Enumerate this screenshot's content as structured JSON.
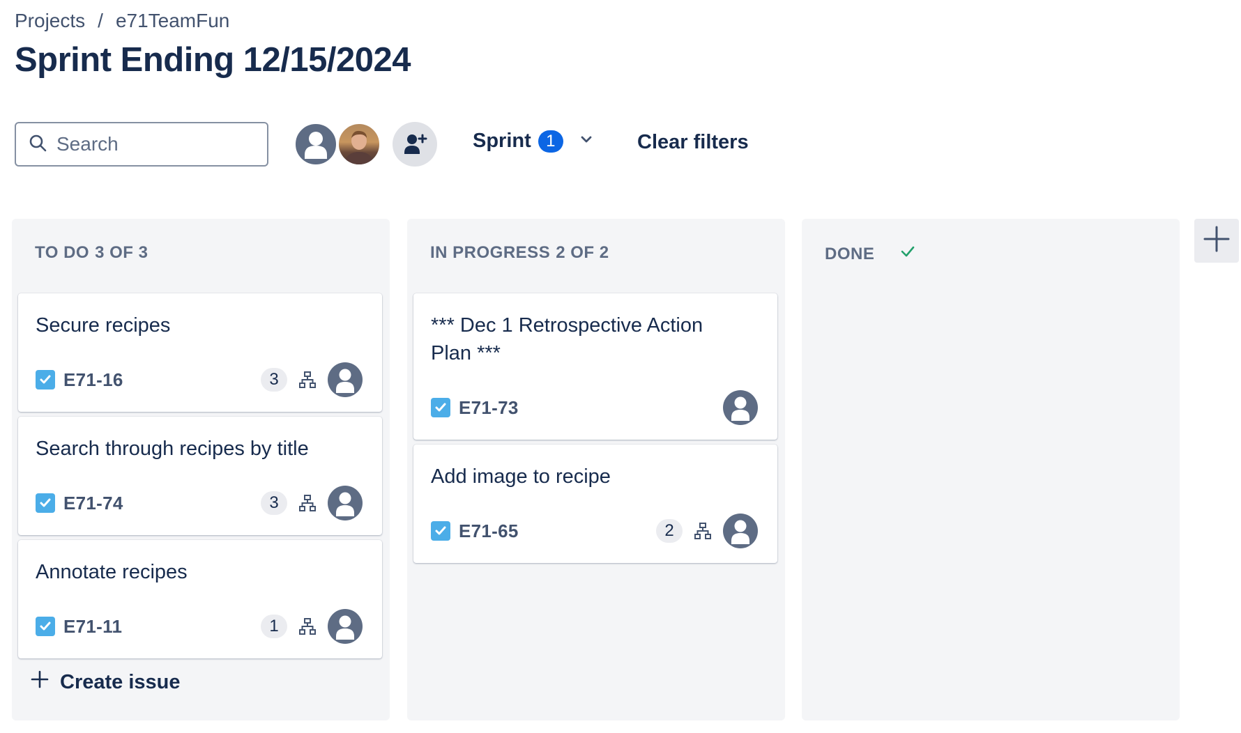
{
  "breadcrumb": {
    "projects": "Projects",
    "separator": "/",
    "project": "e71TeamFun"
  },
  "page_title": "Sprint Ending 12/15/2024",
  "toolbar": {
    "search_placeholder": "Search",
    "sprint_label": "Sprint",
    "sprint_count": "1",
    "clear_filters": "Clear filters"
  },
  "columns": [
    {
      "name": "TO DO",
      "count_text": "3 OF 3",
      "cards": [
        {
          "title": "Secure recipes",
          "key": "E71-16",
          "subtasks": "3"
        },
        {
          "title": "Search through recipes by title",
          "key": "E71-74",
          "subtasks": "3"
        },
        {
          "title": "Annotate recipes",
          "key": "E71-11",
          "subtasks": "1"
        }
      ],
      "create_issue": "Create issue"
    },
    {
      "name": "IN PROGRESS",
      "count_text": "2 OF 2",
      "cards": [
        {
          "title": "*** Dec 1 Retrospective Action Plan ***",
          "key": "E71-73"
        },
        {
          "title": "Add image to recipe",
          "key": "E71-65",
          "subtasks": "2"
        }
      ]
    },
    {
      "name": "DONE",
      "cards": []
    }
  ],
  "colors": {
    "accent": "#0c66e4",
    "checkbox": "#4bade8",
    "done_check": "#22a06b",
    "column_bg": "#f4f5f7"
  }
}
